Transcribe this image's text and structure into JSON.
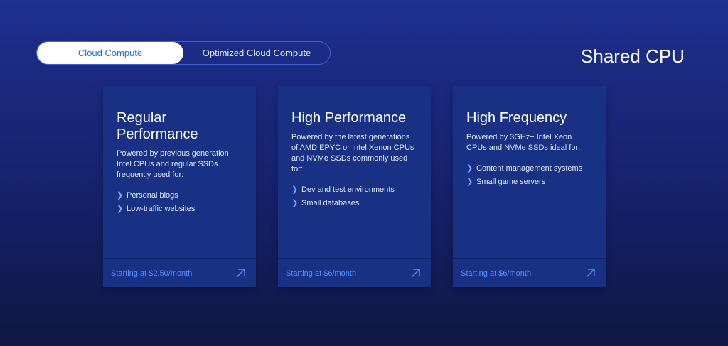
{
  "tabs": {
    "active": "Cloud Compute",
    "inactive": "Optimized Cloud Compute"
  },
  "section_title": "Shared CPU",
  "cards": [
    {
      "title_line1": "Regular",
      "title_line2": "Performance",
      "description": "Powered by previous generation Intel CPUs and regular SSDs frequently used for:",
      "items": [
        "Personal blogs",
        "Low-traffic websites"
      ],
      "price": "Starting at $2.50/month"
    },
    {
      "title_line1": "High Performance",
      "title_line2": "",
      "description": "Powered by the latest generations of AMD EPYC or Intel Xenon CPUs and NVMe SSDs commonly used for:",
      "items": [
        "Dev and test environments",
        "Small databases"
      ],
      "price": "Starting at $6/month"
    },
    {
      "title_line1": "High Frequency",
      "title_line2": "",
      "description": "Powered by 3GHz+ Intel Xeon CPUs and NVMe SSDs ideal for:",
      "items": [
        "Content management systems",
        "Small game servers"
      ],
      "price": "Starting at $6/month"
    }
  ],
  "colors": {
    "accent": "#1e6fe0",
    "card_bg": "#183184",
    "link": "#4f8fff"
  },
  "icons": {
    "list_bullet": "chevron-right-icon",
    "footer": "arrow-up-right-icon"
  }
}
